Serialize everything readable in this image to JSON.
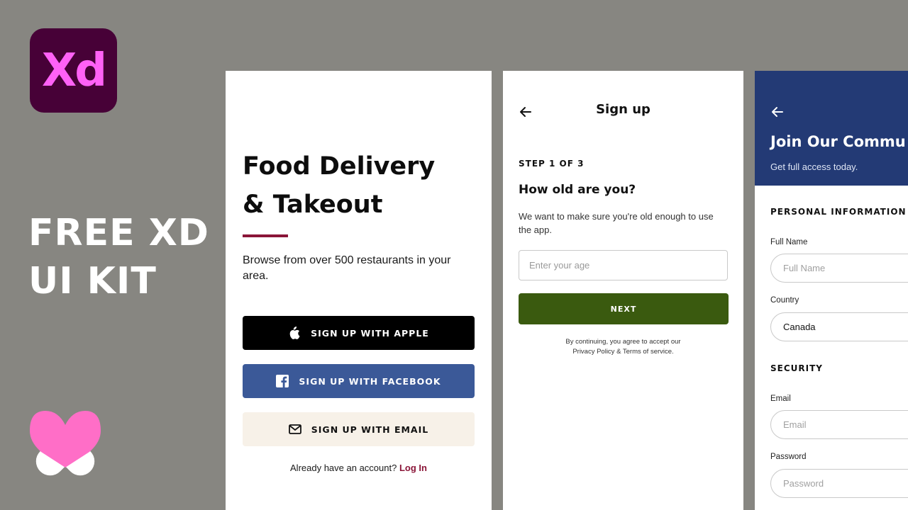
{
  "promo": {
    "logo_text": "Xd",
    "title_line1": "FREE XD",
    "title_line2": "UI KIT",
    "colors": {
      "logo_bg": "#470137",
      "logo_text": "#ff61f6",
      "brand_pink": "#ff6ec7"
    }
  },
  "welcome_screen": {
    "heading_line1": "Food Delivery",
    "heading_line2": "& Takeout",
    "subtitle": "Browse from over 500 restaurants in your area.",
    "buttons": {
      "apple": {
        "label": "SIGN UP WITH APPLE",
        "icon": "apple-icon"
      },
      "facebook": {
        "label": "SIGN UP WITH FACEBOOK",
        "icon": "facebook-icon"
      },
      "email": {
        "label": "SIGN UP WITH EMAIL",
        "icon": "mail-icon"
      }
    },
    "login_prompt": "Already have an account?",
    "login_link": "Log In",
    "colors": {
      "accent": "#8a1538",
      "facebook": "#3b5998",
      "email_bg": "#f7f1e8"
    }
  },
  "signup_screen": {
    "title": "Sign up",
    "step": "STEP 1 OF 3",
    "question": "How old are you?",
    "description": "We want to make sure you're old enough to use the app.",
    "age_input": {
      "placeholder": "Enter your age",
      "value": ""
    },
    "next_label": "NEXT",
    "terms_line1": "By continuing, you agree to accept our",
    "terms_line2": "Privacy Policy & Terms of service.",
    "colors": {
      "next_button": "#3a5a0f"
    }
  },
  "join_screen": {
    "title": "Join Our Commu",
    "subtitle": "Get full access today.",
    "personal_section": "PERSONAL INFORMATION",
    "full_name": {
      "label": "Full Name",
      "placeholder": "Full Name"
    },
    "country": {
      "label": "Country",
      "value": "Canada"
    },
    "security_section": "SECURITY",
    "email": {
      "label": "Email",
      "placeholder": "Email"
    },
    "password": {
      "label": "Password",
      "placeholder": "Password"
    },
    "colors": {
      "header_bg": "#233a75"
    }
  }
}
